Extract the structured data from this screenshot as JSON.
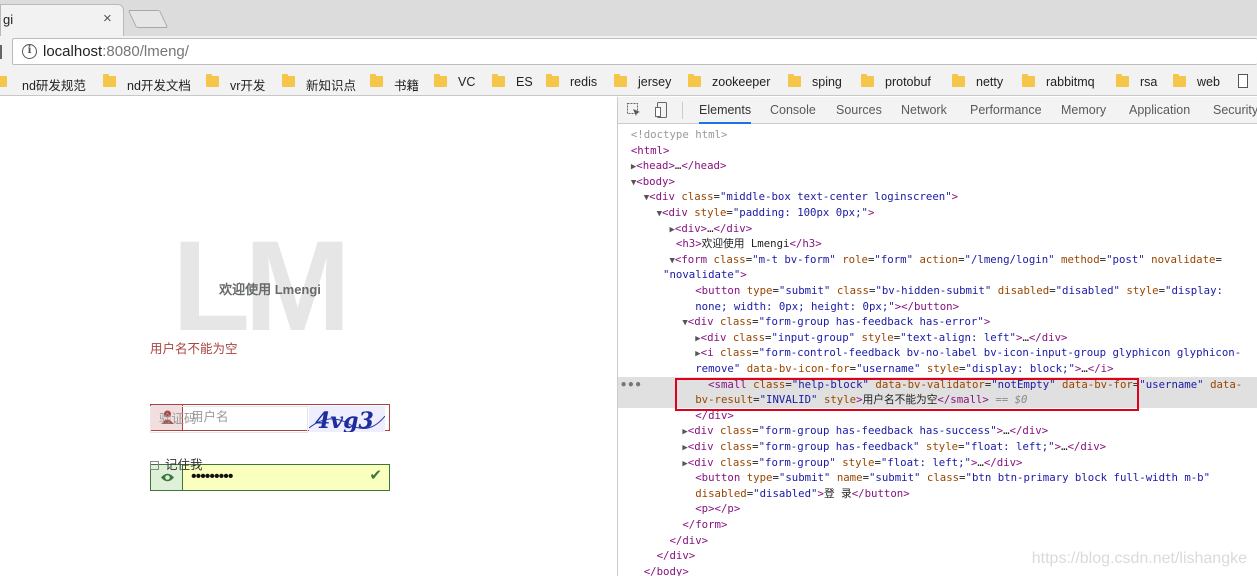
{
  "browser": {
    "tab_title": "gi",
    "tab_close": "×",
    "url_host": "localhost",
    "url_rest": ":8080/lmeng/",
    "bookmarks": [
      "nd研发规范",
      "nd开发文档",
      "vr开发",
      "新知识点",
      "书籍",
      "VC",
      "ES",
      "redis",
      "jersey",
      "zookeeper",
      "sping",
      "protobuf",
      "netty",
      "rabbitmq",
      "rsa",
      "web"
    ]
  },
  "login": {
    "logo": "LM",
    "welcome": "欢迎使用 Lmengi",
    "username_placeholder": "用户名",
    "username_error": "用户名不能为空",
    "password_dots": "•••••••••",
    "captcha_placeholder": "验证码",
    "captcha_text": "4vg3",
    "remember": "记住我",
    "colors": {
      "error": "#a94442",
      "success": "#3c763d",
      "autofill": "#faffbd"
    }
  },
  "devtools": {
    "tabs": [
      "Elements",
      "Console",
      "Sources",
      "Network",
      "Performance",
      "Memory",
      "Application",
      "Security"
    ],
    "active_tab": "Elements",
    "watermark": "https://blog.csdn.net/lishangke"
  }
}
